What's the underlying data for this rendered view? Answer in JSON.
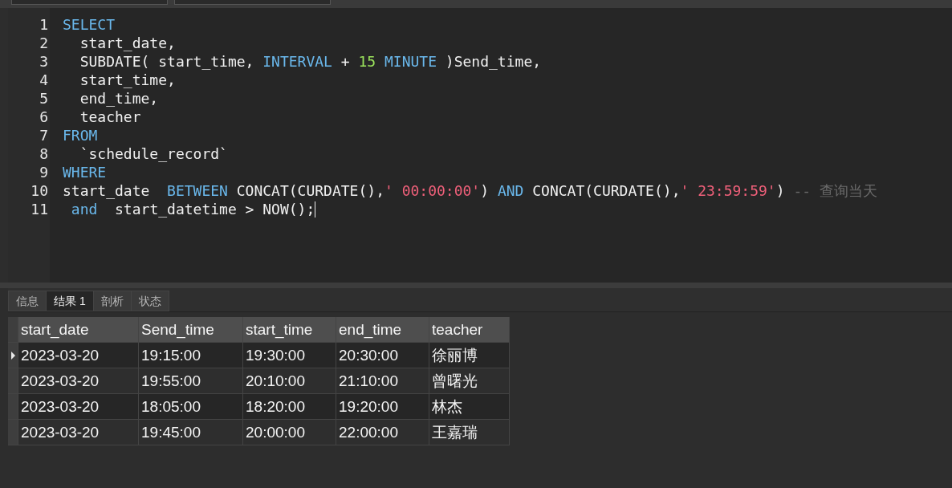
{
  "editor": {
    "lines": [
      {
        "number": "1",
        "tokens": [
          {
            "kind": "keyword",
            "text": "SELECT"
          }
        ]
      },
      {
        "number": "2",
        "tokens": [
          {
            "kind": "plain",
            "text": "  start_date,"
          }
        ]
      },
      {
        "number": "3",
        "tokens": [
          {
            "kind": "plain",
            "text": "  SUBDATE( start_time, "
          },
          {
            "kind": "keyword",
            "text": "INTERVAL"
          },
          {
            "kind": "plain",
            "text": " + "
          },
          {
            "kind": "number",
            "text": "15"
          },
          {
            "kind": "keyword",
            "text": " MINUTE"
          },
          {
            "kind": "plain",
            "text": " )Send_time,"
          }
        ]
      },
      {
        "number": "4",
        "tokens": [
          {
            "kind": "plain",
            "text": "  start_time,"
          }
        ]
      },
      {
        "number": "5",
        "tokens": [
          {
            "kind": "plain",
            "text": "  end_time,"
          }
        ]
      },
      {
        "number": "6",
        "tokens": [
          {
            "kind": "plain",
            "text": "  teacher"
          }
        ]
      },
      {
        "number": "7",
        "tokens": [
          {
            "kind": "keyword",
            "text": "FROM"
          }
        ]
      },
      {
        "number": "8",
        "tokens": [
          {
            "kind": "plain",
            "text": "  `schedule_record`"
          }
        ]
      },
      {
        "number": "9",
        "tokens": [
          {
            "kind": "keyword",
            "text": "WHERE"
          }
        ]
      },
      {
        "number": "10",
        "tokens": [
          {
            "kind": "plain",
            "text": "start_date  "
          },
          {
            "kind": "keyword",
            "text": "BETWEEN"
          },
          {
            "kind": "plain",
            "text": " CONCAT(CURDATE(),"
          },
          {
            "kind": "string",
            "text": "' 00:00:00'"
          },
          {
            "kind": "plain",
            "text": ") "
          },
          {
            "kind": "keyword",
            "text": "AND"
          },
          {
            "kind": "plain",
            "text": " CONCAT(CURDATE(),"
          },
          {
            "kind": "string",
            "text": "' 23:59:59'"
          },
          {
            "kind": "plain",
            "text": ") "
          },
          {
            "kind": "comment",
            "text": "-- 查询当天"
          }
        ]
      },
      {
        "number": "11",
        "tokens": [
          {
            "kind": "keyword",
            "text": " and"
          },
          {
            "kind": "plain",
            "text": "  start_datetime > NOW();"
          }
        ]
      }
    ]
  },
  "result_tabs": [
    {
      "label": "信息",
      "selected": false
    },
    {
      "label": "结果 1",
      "selected": true
    },
    {
      "label": "剖析",
      "selected": false
    },
    {
      "label": "状态",
      "selected": false
    }
  ],
  "table": {
    "columns": [
      "start_date",
      "Send_time",
      "start_time",
      "end_time",
      "teacher"
    ],
    "rows": [
      {
        "selected": true,
        "cells": [
          "2023-03-20",
          "19:15:00",
          "19:30:00",
          "20:30:00",
          "徐丽博"
        ]
      },
      {
        "selected": false,
        "cells": [
          "2023-03-20",
          "19:55:00",
          "20:10:00",
          "21:10:00",
          "曾曙光"
        ]
      },
      {
        "selected": false,
        "cells": [
          "2023-03-20",
          "18:05:00",
          "18:20:00",
          "19:20:00",
          "林杰"
        ]
      },
      {
        "selected": false,
        "cells": [
          "2023-03-20",
          "19:45:00",
          "20:00:00",
          "22:00:00",
          "王嘉瑞"
        ]
      }
    ]
  }
}
